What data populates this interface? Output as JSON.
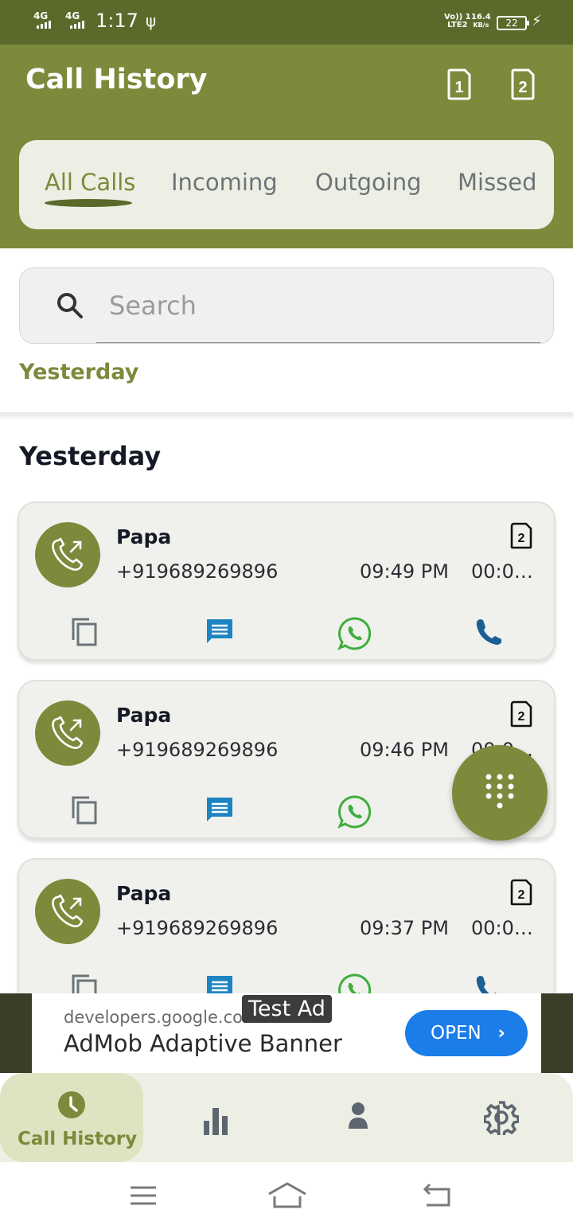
{
  "status_bar": {
    "sim1_net": "4G",
    "sim2_net": "4G",
    "time": "1:17",
    "volte": "Vo)) 1",
    "lte": "LTE2",
    "speed_value": "16.4",
    "speed_unit": "KB/s",
    "battery": "22"
  },
  "header": {
    "title": "Call History",
    "sim1_label": "1",
    "sim2_label": "2"
  },
  "tabs": [
    {
      "label": "All Calls",
      "active": true
    },
    {
      "label": "Incoming",
      "active": false
    },
    {
      "label": "Outgoing",
      "active": false
    },
    {
      "label": "Missed",
      "active": false
    }
  ],
  "search": {
    "placeholder": "Search"
  },
  "filter": {
    "label": "Yesterday"
  },
  "section": {
    "title": "Yesterday"
  },
  "calls": [
    {
      "name": "Papa",
      "number": "+919689269896",
      "time": "09:49 PM",
      "duration": "00:00 ...",
      "sim": "2",
      "type": "outgoing"
    },
    {
      "name": "Papa",
      "number": "+919689269896",
      "time": "09:46 PM",
      "duration": "00:00 ...",
      "sim": "2",
      "type": "outgoing"
    },
    {
      "name": "Papa",
      "number": "+919689269896",
      "time": "09:37 PM",
      "duration": "00:00 ...",
      "sim": "2",
      "type": "outgoing"
    }
  ],
  "ad": {
    "domain": "developers.google.com",
    "headline": "AdMob Adaptive Banner",
    "badge": "Test Ad",
    "button": "OPEN"
  },
  "bottom_nav": {
    "active_label": "Call History",
    "items": [
      "clock-icon",
      "bar-chart-icon",
      "person-icon",
      "gear-icon"
    ]
  },
  "colors": {
    "primary": "#7b8a3b",
    "status_bar": "#5a6a2a",
    "message_blue": "#1d84c2",
    "whatsapp_green": "#3fae3f",
    "ad_button": "#1a7de8"
  }
}
